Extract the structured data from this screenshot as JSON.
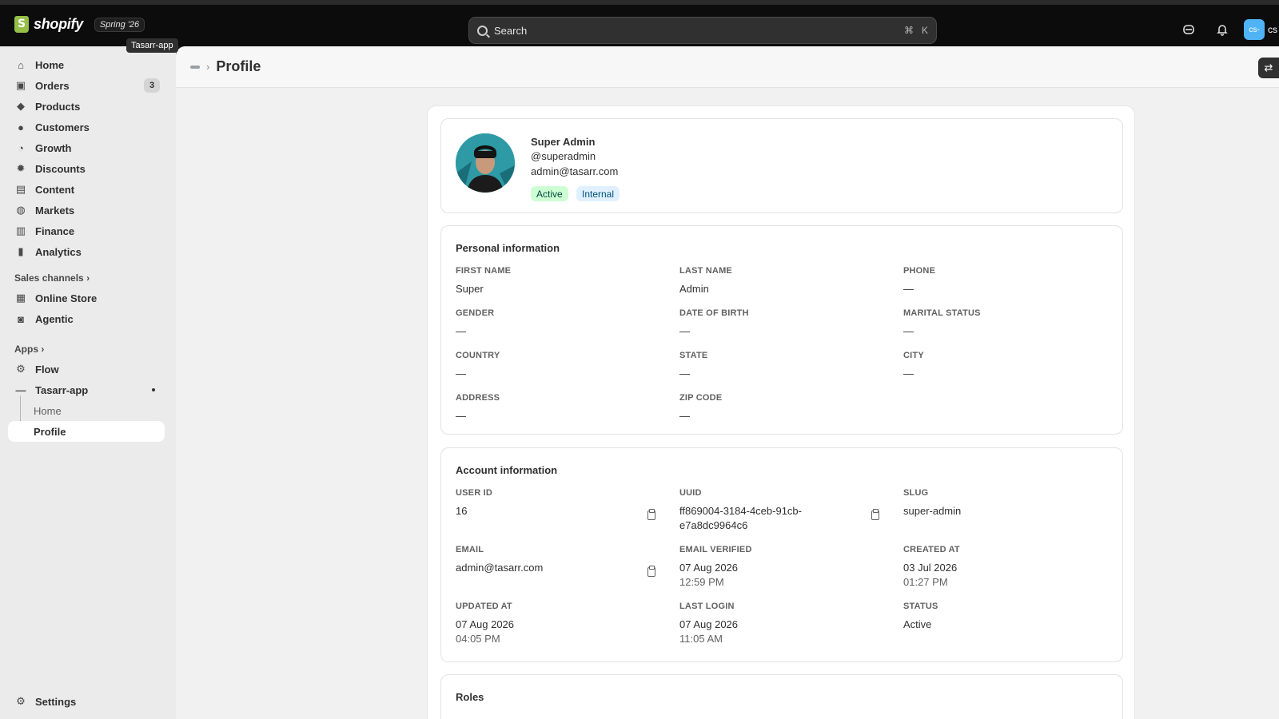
{
  "topbar": {
    "logo_text": "shopify",
    "edition": "Spring '26",
    "tooltip": "Tasarr-app",
    "search_placeholder": "Search",
    "shortcut_cmd": "⌘",
    "shortcut_key": "K",
    "avatar_initials": "cs-",
    "avatar_label": "cs"
  },
  "sidebar": {
    "items": [
      {
        "label": "Home",
        "icon": "home-icon"
      },
      {
        "label": "Orders",
        "icon": "orders-icon",
        "badge": "3"
      },
      {
        "label": "Products",
        "icon": "tag-icon"
      },
      {
        "label": "Customers",
        "icon": "person-icon"
      },
      {
        "label": "Growth",
        "icon": "growth-icon"
      },
      {
        "label": "Discounts",
        "icon": "discount-icon"
      },
      {
        "label": "Content",
        "icon": "content-icon"
      },
      {
        "label": "Markets",
        "icon": "globe-icon"
      },
      {
        "label": "Finance",
        "icon": "bank-icon"
      },
      {
        "label": "Analytics",
        "icon": "bar-chart-icon"
      }
    ],
    "sales_channels": "Sales channels",
    "channels": [
      {
        "label": "Online Store",
        "icon": "store-icon"
      },
      {
        "label": "Agentic",
        "icon": "agent-icon"
      }
    ],
    "apps": "Apps",
    "app_items": [
      {
        "label": "Flow",
        "icon": "flow-icon"
      },
      {
        "label": "Tasarr-app",
        "icon": "app-icon"
      }
    ],
    "app_sub": [
      {
        "label": "Home"
      },
      {
        "label": "Profile"
      }
    ],
    "settings": "Settings"
  },
  "page": {
    "title": "Profile"
  },
  "profile": {
    "name": "Super Admin",
    "username": "@superadmin",
    "email": "admin@tasarr.com",
    "status_badge": "Active",
    "type_badge": "Internal"
  },
  "personal": {
    "title": "Personal information",
    "fields": [
      {
        "label": "FIRST NAME",
        "value": "Super"
      },
      {
        "label": "LAST NAME",
        "value": "Admin"
      },
      {
        "label": "PHONE",
        "value": "—"
      },
      {
        "label": "GENDER",
        "value": "—"
      },
      {
        "label": "DATE OF BIRTH",
        "value": "—"
      },
      {
        "label": "MARITAL STATUS",
        "value": "—"
      },
      {
        "label": "COUNTRY",
        "value": "—"
      },
      {
        "label": "STATE",
        "value": "—"
      },
      {
        "label": "CITY",
        "value": "—"
      },
      {
        "label": "ADDRESS",
        "value": "—"
      },
      {
        "label": "ZIP CODE",
        "value": "—"
      }
    ]
  },
  "account": {
    "title": "Account information",
    "user_id": {
      "label": "USER ID",
      "value": "16"
    },
    "uuid": {
      "label": "UUID",
      "value": "ff869004-3184-4ceb-91cb-",
      "value2": "e7a8dc9964c6"
    },
    "slug": {
      "label": "SLUG",
      "value": "super-admin"
    },
    "email": {
      "label": "EMAIL",
      "value": "admin@tasarr.com"
    },
    "email_verified": {
      "label": "EMAIL VERIFIED",
      "value": "07 Aug 2026",
      "time": "12:59 PM"
    },
    "created_at": {
      "label": "CREATED AT",
      "value": "03 Jul 2026",
      "time": "01:27 PM"
    },
    "updated_at": {
      "label": "UPDATED AT",
      "value": "07 Aug 2026",
      "time": "04:05 PM"
    },
    "last_login": {
      "label": "LAST LOGIN",
      "value": "07 Aug 2026",
      "time": "11:05 AM"
    },
    "status": {
      "label": "STATUS",
      "value": "Active"
    }
  },
  "roles": {
    "title": "Roles"
  }
}
